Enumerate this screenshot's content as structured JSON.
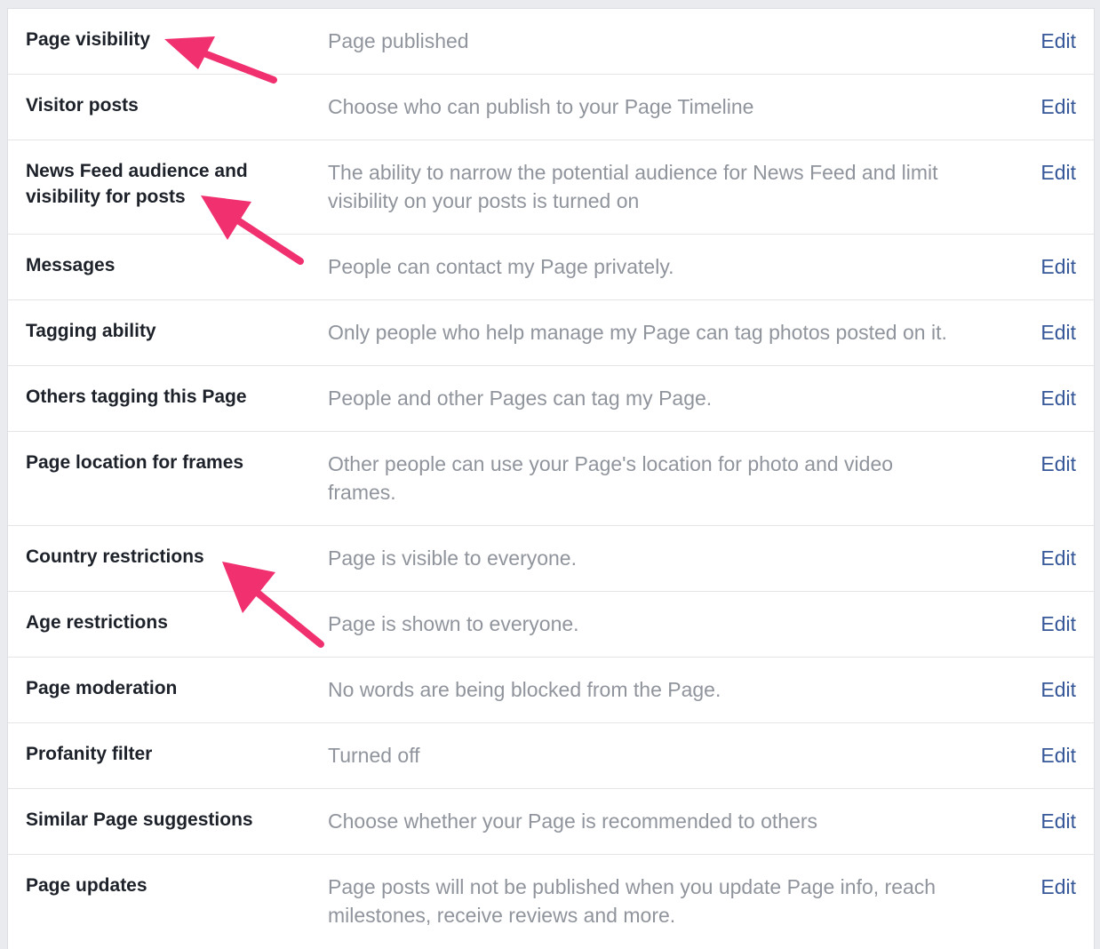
{
  "settings": {
    "rows": [
      {
        "label": "Page visibility",
        "value": "Page published",
        "edit": "Edit"
      },
      {
        "label": "Visitor posts",
        "value": "Choose who can publish to your Page Timeline",
        "edit": "Edit"
      },
      {
        "label": "News Feed audience and visibility for posts",
        "value": "The ability to narrow the potential audience for News Feed and limit visibility on your posts is turned on",
        "edit": "Edit"
      },
      {
        "label": "Messages",
        "value": "People can contact my Page privately.",
        "edit": "Edit"
      },
      {
        "label": "Tagging ability",
        "value": "Only people who help manage my Page can tag photos posted on it.",
        "edit": "Edit"
      },
      {
        "label": "Others tagging this Page",
        "value": "People and other Pages can tag my Page.",
        "edit": "Edit"
      },
      {
        "label": "Page location for frames",
        "value": "Other people can use your Page's location for photo and video frames.",
        "edit": "Edit"
      },
      {
        "label": "Country restrictions",
        "value": "Page is visible to everyone.",
        "edit": "Edit"
      },
      {
        "label": "Age restrictions",
        "value": "Page is shown to everyone.",
        "edit": "Edit"
      },
      {
        "label": "Page moderation",
        "value": "No words are being blocked from the Page.",
        "edit": "Edit"
      },
      {
        "label": "Profanity filter",
        "value": "Turned off",
        "edit": "Edit"
      },
      {
        "label": "Similar Page suggestions",
        "value": "Choose whether your Page is recommended to others",
        "edit": "Edit"
      },
      {
        "label": "Page updates",
        "value": "Page posts will not be published when you update Page info, reach milestones, receive reviews and more.",
        "edit": "Edit"
      }
    ]
  },
  "colors": {
    "label": "#1d2129",
    "value": "#90949c",
    "link": "#365899",
    "annotation_arrow": "#f0306f"
  }
}
